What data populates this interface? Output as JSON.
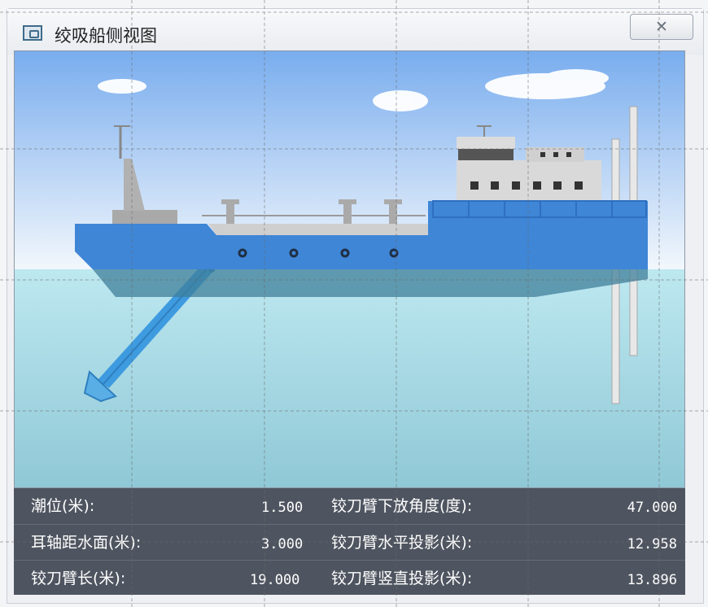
{
  "window": {
    "title": "绞吸船侧视图",
    "close_glyph": "✕"
  },
  "icons": {
    "app": "window-app-icon",
    "close": "close-icon"
  },
  "colors": {
    "hull": "#3f86d6",
    "deck": "#c9c9c9",
    "sky_top": "#7fb0ee",
    "water": "#b7e6ef",
    "info_panel": "#4f5560",
    "cutter_arm": "#3e9be0"
  },
  "info": {
    "rows": [
      {
        "left_label": "潮位(米):",
        "left_value": "1.500",
        "right_label": "铰刀臂下放角度(度):",
        "right_value": "47.000"
      },
      {
        "left_label": "耳轴距水面(米):",
        "left_value": "3.000",
        "right_label": "铰刀臂水平投影(米):",
        "right_value": "12.958"
      },
      {
        "left_label": "铰刀臂长(米):",
        "left_value": "19.000",
        "right_label": "铰刀臂竖直投影(米):",
        "right_value": "13.896"
      }
    ]
  }
}
